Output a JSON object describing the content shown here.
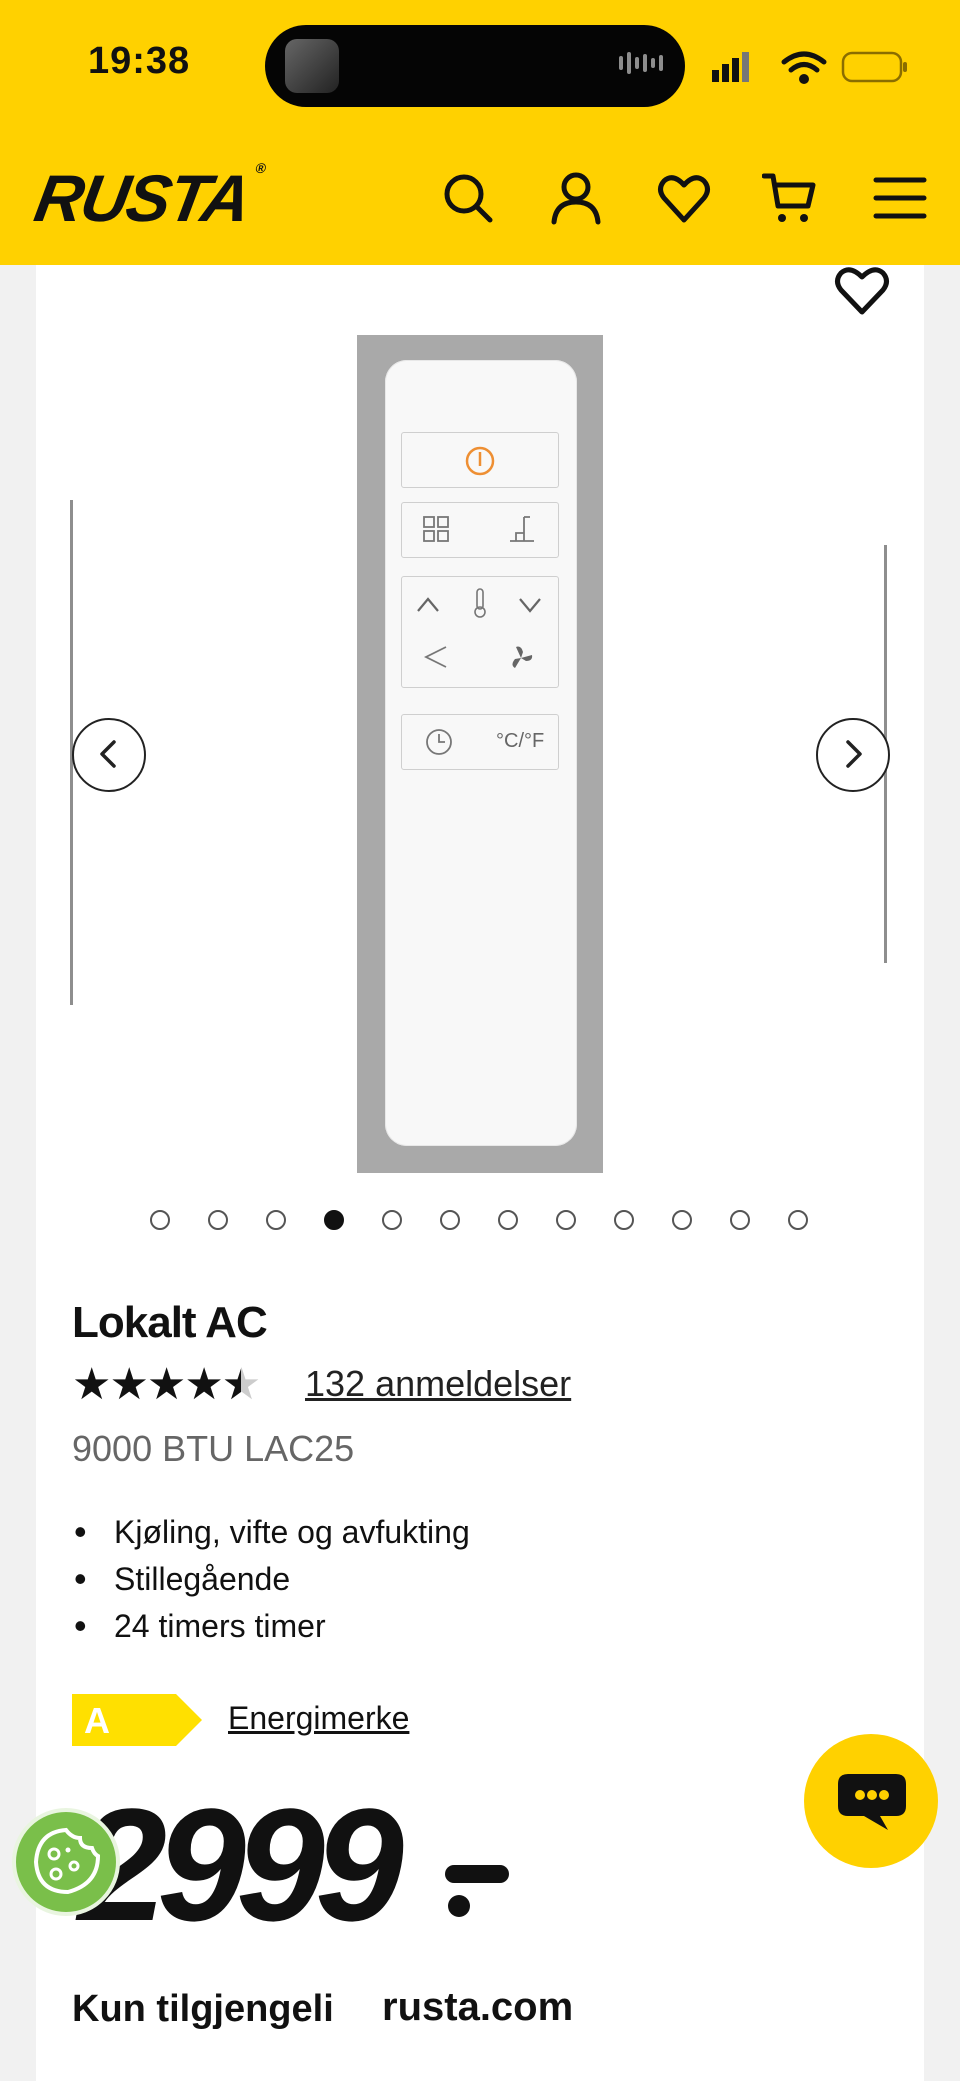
{
  "status_bar": {
    "time": "19:38"
  },
  "header": {
    "logo": "RUSTA",
    "icons": [
      "search-icon",
      "account-icon",
      "heart-icon",
      "cart-icon",
      "menu-icon"
    ],
    "background": "#ffd100"
  },
  "gallery": {
    "image_description_icons": [
      "power-icon",
      "mode-icon",
      "sleep-icon",
      "up-icon",
      "thermometer-icon",
      "down-icon",
      "swing-icon",
      "fan-icon",
      "timer-icon"
    ],
    "remote_label_celsius_fahrenheit": "°C/°F",
    "dots_total": 12,
    "active_dot": 4
  },
  "product": {
    "title": "Lokalt AC",
    "rating": 4.5,
    "rating_stars": "★★★★★",
    "reviews": "132 anmeldelser",
    "subtitle": "9000 BTU LAC25",
    "features": [
      "Kjøling, vifte og avfukting",
      "Stillegående",
      "24 timers timer"
    ],
    "energy_class": "A",
    "energy_link": "Energimerke",
    "price": "2999",
    "availability": "Kun tilgjengeli",
    "url": "rusta.com"
  },
  "colors": {
    "brand": "#ffd100",
    "energy": "#ffe000",
    "cookie": "#7abf4a"
  }
}
